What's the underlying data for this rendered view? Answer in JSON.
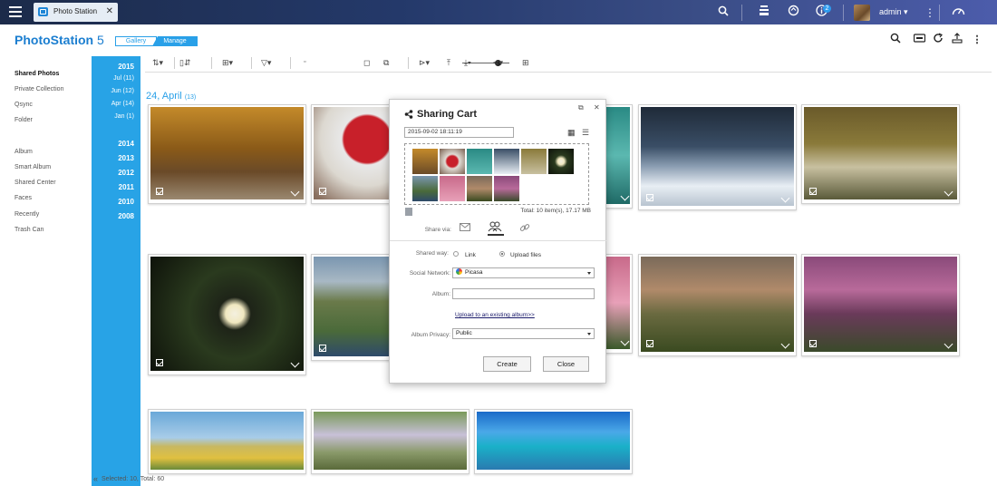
{
  "topbar": {
    "app_tab_label": "Photo Station",
    "notification_count": "2",
    "user": "admin"
  },
  "header": {
    "logo_bold": "PhotoStation",
    "logo_version": " 5",
    "tab_gallery": "Gallery",
    "tab_manage": "Manage"
  },
  "sidebar": {
    "items": [
      "Shared Photos",
      "Private Collection",
      "Qsync",
      "Folder",
      "Album",
      "Smart Album",
      "Shared Center",
      "Faces",
      "Recently",
      "Trash Can"
    ],
    "active": "Shared Photos"
  },
  "timeline": {
    "years_top": "2015",
    "months": [
      "Jul (11)",
      "Jun (12)",
      "Apr (14)",
      "Jan (1)"
    ],
    "years": [
      "2014",
      "2013",
      "2012",
      "2011",
      "2010",
      "2008"
    ]
  },
  "content": {
    "date_label": "24, April",
    "date_count": "(13)"
  },
  "status": {
    "text": "Selected: 10, Total: 60"
  },
  "dialog": {
    "title": "Sharing Cart",
    "date_value": "2015-09-02 18:11:19",
    "total": "Total: 10 item(s), 17.17 MB",
    "share_via_label": "Share via:",
    "shared_way_label": "Shared way:",
    "option_link": "Link",
    "option_upload": "Upload files",
    "social_network_label": "Social Network:",
    "social_network_value": "Picasa",
    "album_label": "Album:",
    "album_value": "",
    "upload_existing_link": "Upload to an existing album>>",
    "album_privacy_label": "Album Privacy:",
    "album_privacy_value": "Public",
    "create_button": "Create",
    "close_button": "Close"
  },
  "colors": {
    "accent": "#29a0e8",
    "timeline_bg": "#28a3e6",
    "topbar": "#24396a"
  },
  "icons": [
    "menu-icon",
    "search-icon",
    "stack-icon",
    "sync-icon",
    "info-icon",
    "more-vertical-icon",
    "dashboard-icon",
    "close-icon",
    "grid-view-icon",
    "list-view-icon",
    "email-icon",
    "social-icon",
    "link-icon",
    "trash-icon",
    "share-icon"
  ]
}
